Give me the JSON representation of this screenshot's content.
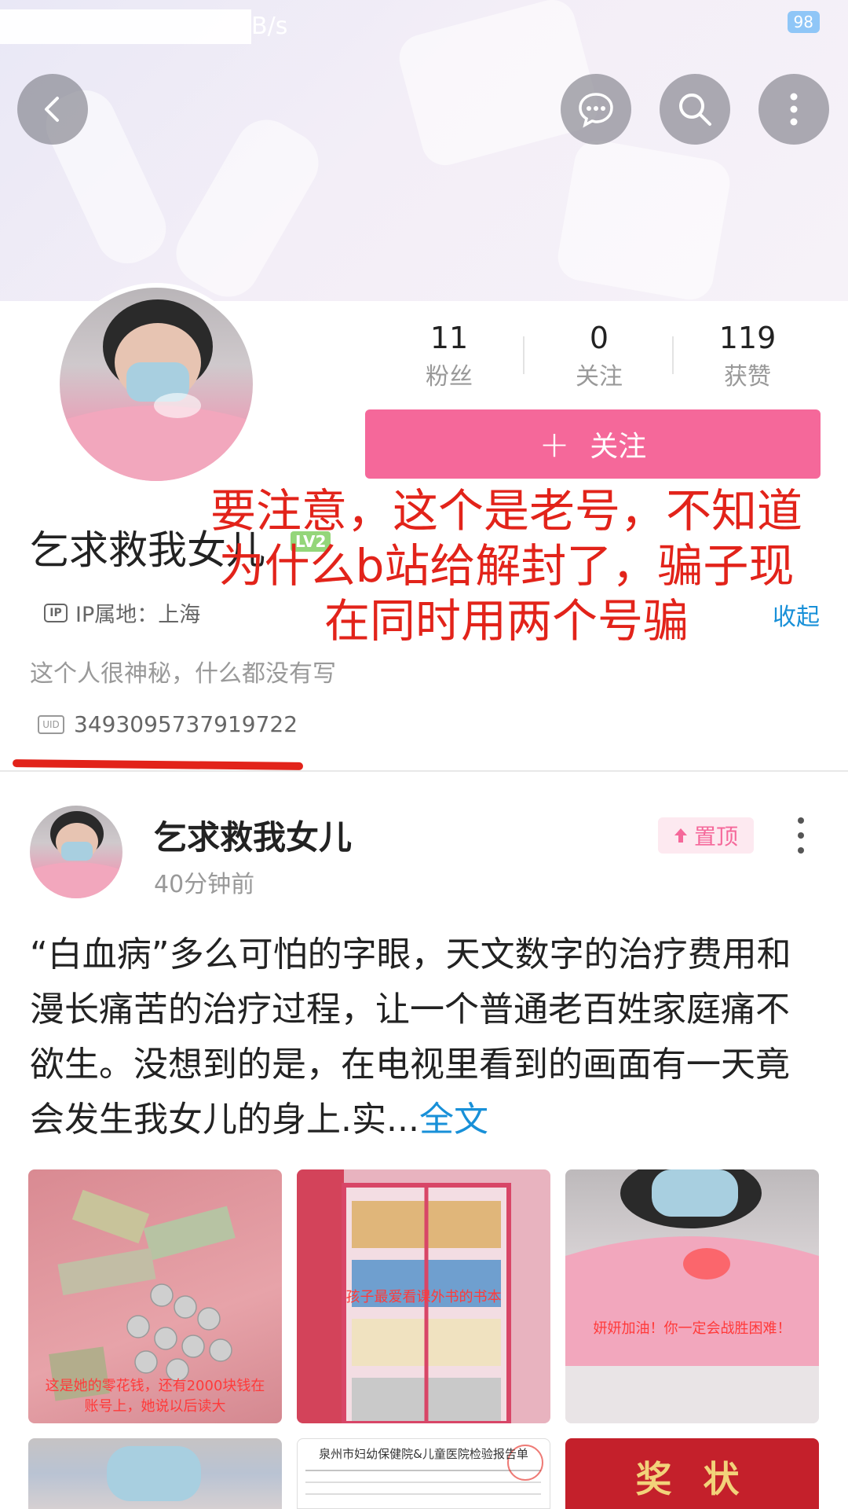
{
  "status_bar": {
    "speed": "B/s",
    "battery": "98"
  },
  "header": {
    "back_icon": "chevron-left-icon",
    "message_icon": "chat-bubble-icon",
    "search_icon": "search-icon",
    "more_icon": "more-vertical-icon"
  },
  "profile": {
    "stats": [
      {
        "value": "11",
        "label": "粉丝"
      },
      {
        "value": "0",
        "label": "关注"
      },
      {
        "value": "119",
        "label": "获赞"
      }
    ],
    "follow_label": "关注",
    "name": "乞求救我女儿",
    "level": "LV2",
    "ip_location": "IP属地：上海",
    "collapse_label": "收起",
    "bio": "这个人很神秘，什么都没有写",
    "uid": "3493095737919722"
  },
  "annotation": "要注意，这个是老号，不知道为什么b站给解封了，骗子现在同时用两个号骗",
  "post": {
    "author": "乞求救我女儿",
    "time": "40分钟前",
    "pinned_label": "置顶",
    "text": "“白血病”多么可怕的字眼，天文数字的治疗费用和漫长痛苦的治疗过程，让一个普通老百姓家庭痛不欲生。没想到的是，在电视里看到的画面有一天竟会发生我女儿的身上.实...",
    "full_text_label": "全文",
    "images": [
      {
        "caption": "这是她的零花钱，还有2000块钱在账号上，她说以后读大"
      },
      {
        "caption": "孩子最爱看课外书的书本"
      },
      {
        "caption": "妍妍加油！你一定会战胜困难！"
      },
      {
        "caption": ""
      },
      {
        "caption": "泉州市妇幼保健院&儿童医院检验报告单"
      },
      {
        "caption": "奖 状"
      }
    ]
  }
}
